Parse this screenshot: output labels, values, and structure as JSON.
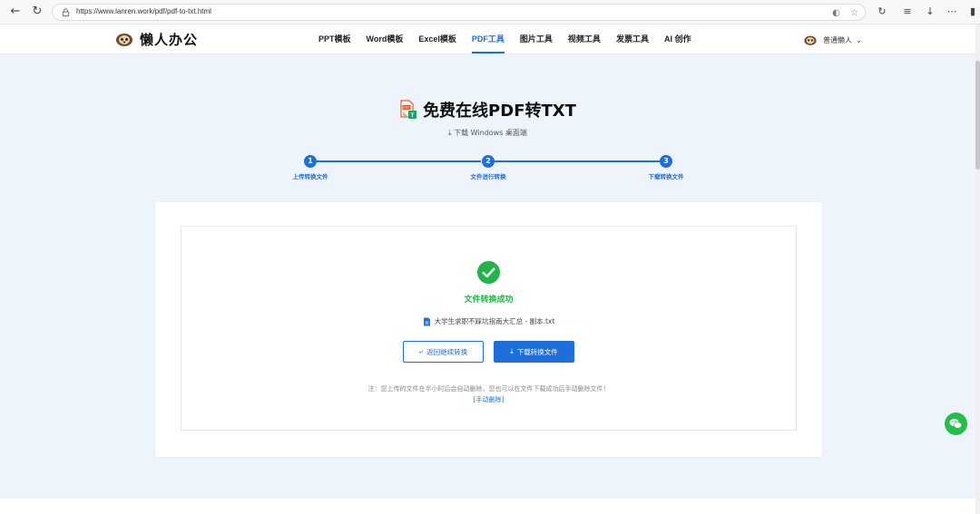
{
  "browser": {
    "url": "https://www.lanren.work/pdf/pdf-to-txt.html"
  },
  "header": {
    "logo_text": "懒人办公",
    "nav": [
      {
        "label": "PPT模板",
        "active": false
      },
      {
        "label": "Word模板",
        "active": false
      },
      {
        "label": "Excel模板",
        "active": false
      },
      {
        "label": "PDF工具",
        "active": true
      },
      {
        "label": "图片工具",
        "active": false
      },
      {
        "label": "视频工具",
        "active": false
      },
      {
        "label": "发票工具",
        "active": false
      },
      {
        "label": "AI 创作",
        "active": false
      }
    ],
    "user_name": "普通懒人"
  },
  "main": {
    "title": "免费在线PDF转TXT",
    "download_desktop": "下载 Windows 桌面端",
    "steps": [
      {
        "number": "1",
        "label": "上传转换文件"
      },
      {
        "number": "2",
        "label": "文件进行转换"
      },
      {
        "number": "3",
        "label": "下载转换文件"
      }
    ],
    "result": {
      "status": "文件转换成功",
      "file_name": "大学生求职不踩坑指南大汇总 - 副本.txt",
      "back_button": "返回继续转换",
      "download_button": "下载转换文件",
      "note": "注：您上传的文件在半小时后会自动删除，您也可以在文件下载成功后手动删除文件！",
      "manual_delete": "[手动删除]"
    }
  },
  "colors": {
    "accent": "#1e6fd9",
    "success": "#22b34a",
    "page_bg": "#eef4fc"
  }
}
